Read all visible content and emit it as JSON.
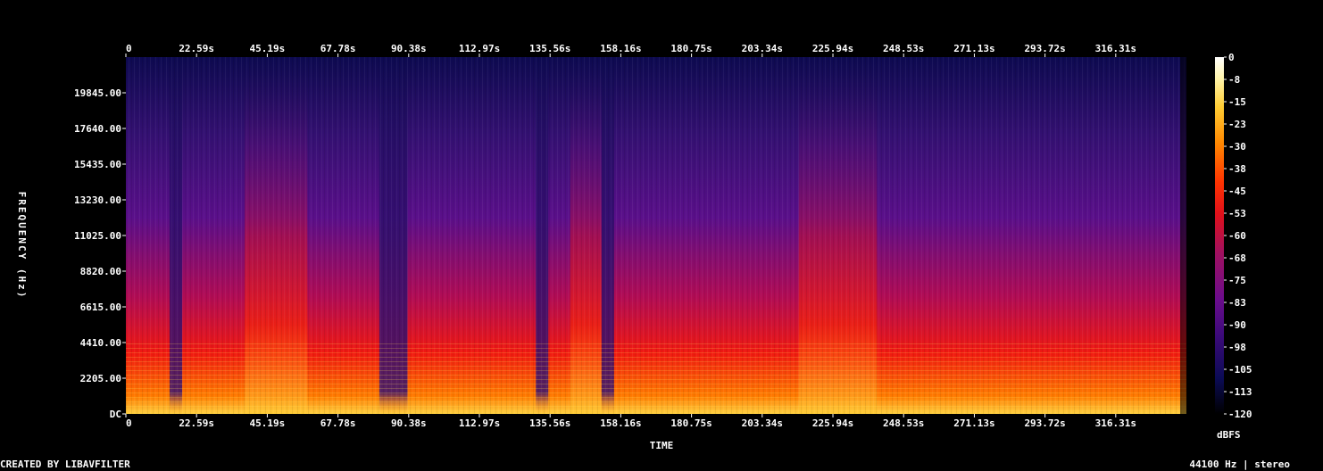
{
  "chart_data": {
    "type": "heatmap",
    "title": "",
    "xlabel": "TIME",
    "ylabel": "FREQUENCY (Hz)",
    "x_ticks": [
      "0",
      "22.59s",
      "45.19s",
      "67.78s",
      "90.38s",
      "112.97s",
      "135.56s",
      "158.16s",
      "180.75s",
      "203.34s",
      "225.94s",
      "248.53s",
      "271.13s",
      "293.72s",
      "316.31s"
    ],
    "x_tick_values": [
      0,
      22.59,
      45.19,
      67.78,
      90.38,
      112.97,
      135.56,
      158.16,
      180.75,
      203.34,
      225.94,
      248.53,
      271.13,
      293.72,
      316.31
    ],
    "xlim": [
      0,
      338.9
    ],
    "y_ticks": [
      "DC",
      "2205.00",
      "4410.00",
      "6615.00",
      "8820.00",
      "11025.00",
      "13230.00",
      "15435.00",
      "17640.00",
      "19845.00"
    ],
    "y_tick_values": [
      0,
      2205,
      4410,
      6615,
      8820,
      11025,
      13230,
      15435,
      17640,
      19845
    ],
    "ylim": [
      0,
      22050
    ],
    "colorbar": {
      "label": "dBFS",
      "ticks": [
        "0",
        "-8",
        "-15",
        "-23",
        "-30",
        "-38",
        "-45",
        "-53",
        "-60",
        "-68",
        "-75",
        "-83",
        "-90",
        "-98",
        "-105",
        "-113",
        "-120"
      ],
      "range": [
        -120,
        0
      ],
      "colors": [
        "#000000",
        "#0b0b55",
        "#3c0a7a",
        "#6a0c8c",
        "#a01060",
        "#e0101a",
        "#ff3300",
        "#ff8800",
        "#ffcc33",
        "#fff4aa",
        "#ffffff"
      ]
    },
    "quiet_segments_s": [
      [
        14,
        18
      ],
      [
        81,
        90
      ],
      [
        131,
        135
      ],
      [
        152,
        156
      ]
    ],
    "loud_segments_s": [
      [
        38,
        58
      ],
      [
        142,
        152
      ],
      [
        215,
        240
      ]
    ]
  },
  "footer": {
    "left": "CREATED BY LIBAVFILTER",
    "right": "44100 Hz | stereo"
  }
}
